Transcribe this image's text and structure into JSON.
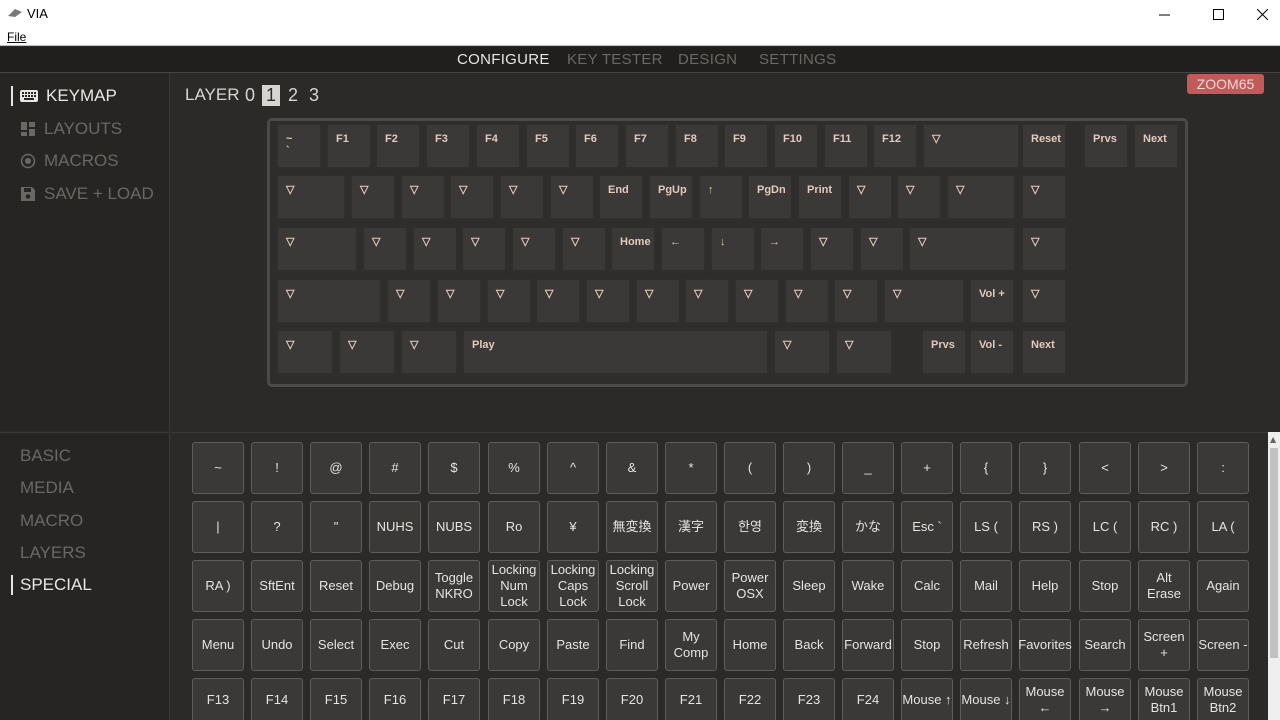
{
  "window": {
    "title": "VIA",
    "menu": [
      "File"
    ]
  },
  "nav": {
    "tabs": [
      "CONFIGURE",
      "KEY TESTER",
      "DESIGN",
      "SETTINGS"
    ],
    "active": 0
  },
  "left_menu": {
    "items": [
      "KEYMAP",
      "LAYOUTS",
      "MACROS",
      "SAVE + LOAD"
    ],
    "active": 0
  },
  "layer": {
    "label": "LAYER",
    "numbers": [
      "0",
      "1",
      "2",
      "3"
    ],
    "selected": 1
  },
  "device": {
    "name": "ZOOM65"
  },
  "keyboard_rows": [
    [
      "~\n`",
      "F1",
      "F2",
      "F3",
      "F4",
      "F5",
      "F6",
      "F7",
      "F8",
      "F9",
      "F10",
      "F11",
      "F12",
      "▽",
      "Reset",
      "Prvs",
      "Next"
    ],
    [
      "▽",
      "▽",
      "▽",
      "▽",
      "▽",
      "▽",
      "End",
      "PgUp",
      "↑",
      "PgDn",
      "Print",
      "▽",
      "▽",
      "▽",
      "▽"
    ],
    [
      "▽",
      "▽",
      "▽",
      "▽",
      "▽",
      "▽",
      "Home",
      "←",
      "↓",
      "→",
      "▽",
      "▽",
      "▽",
      "▽"
    ],
    [
      "▽",
      "▽",
      "▽",
      "▽",
      "▽",
      "▽",
      "▽",
      "▽",
      "▽",
      "▽",
      "▽",
      "▽",
      "Vol +",
      "▽"
    ],
    [
      "▽",
      "▽",
      "▽",
      "Play",
      "▽",
      "▽",
      "Prvs",
      "Vol -",
      "Next"
    ]
  ],
  "categories": {
    "items": [
      "BASIC",
      "MEDIA",
      "MACRO",
      "LAYERS",
      "SPECIAL"
    ],
    "active": 4
  },
  "palette": [
    [
      "~",
      "!",
      "@",
      "#",
      "$",
      "%",
      "^",
      "&",
      "*",
      "(",
      ")",
      "_",
      "+",
      "{",
      "}",
      "<",
      ">",
      ":"
    ],
    [
      "|",
      "?",
      "\"",
      "NUHS",
      "NUBS",
      "Ro",
      "¥",
      "無変換",
      "漢字",
      "한영",
      "変換",
      "かな",
      "Esc `",
      "LS (",
      "RS )",
      "LC (",
      "RC )",
      "LA ("
    ],
    [
      "RA )",
      "SftEnt",
      "Reset",
      "Debug",
      "Toggle\nNKRO",
      "Locking\nNum\nLock",
      "Locking\nCaps\nLock",
      "Locking\nScroll\nLock",
      "Power",
      "Power\nOSX",
      "Sleep",
      "Wake",
      "Calc",
      "Mail",
      "Help",
      "Stop",
      "Alt\nErase",
      "Again"
    ],
    [
      "Menu",
      "Undo",
      "Select",
      "Exec",
      "Cut",
      "Copy",
      "Paste",
      "Find",
      "My\nComp",
      "Home",
      "Back",
      "Forward",
      "Stop",
      "Refresh",
      "Favorites",
      "Search",
      "Screen +",
      "Screen -"
    ],
    [
      "F13",
      "F14",
      "F15",
      "F16",
      "F17",
      "F18",
      "F19",
      "F20",
      "F21",
      "F22",
      "F23",
      "F24",
      "Mouse ↑",
      "Mouse ↓",
      "Mouse\n←",
      "Mouse\n→",
      "Mouse\nBtn1",
      "Mouse\nBtn2"
    ]
  ],
  "colors": {
    "accent": "#c25a5a",
    "key_text": "#e5c9bd",
    "bg": "#2b2a28"
  }
}
